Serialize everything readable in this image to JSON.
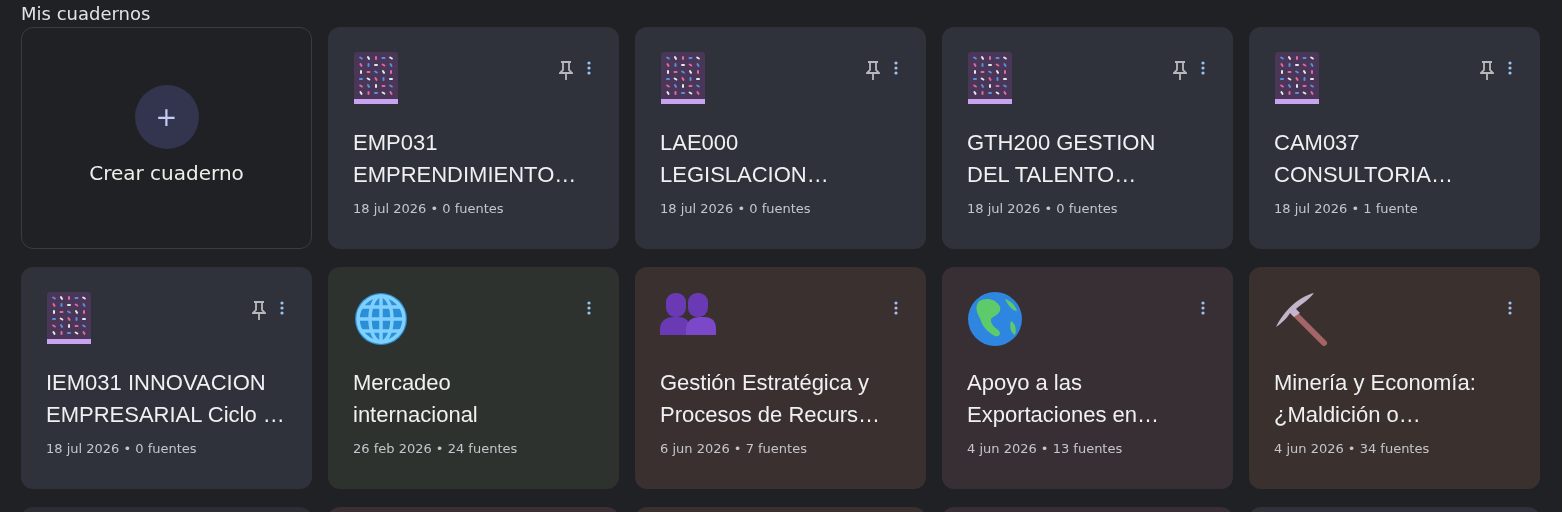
{
  "heading": "Mis cuadernos",
  "create_card": {
    "label": "Crear cuaderno",
    "button": "+"
  },
  "notebooks": [
    {
      "kind": "notebook",
      "color": "#30323b",
      "title": "EMP031\nEMPRENDIMIENTO…",
      "meta": "18 jul 2026 • 0 fuentes",
      "pinned": true
    },
    {
      "kind": "notebook",
      "color": "#30323b",
      "title": "LAE000\nLEGISLACION…",
      "meta": "18 jul 2026 • 0 fuentes",
      "pinned": true
    },
    {
      "kind": "notebook",
      "color": "#30323b",
      "title": "GTH200 GESTION\nDEL TALENTO…",
      "meta": "18 jul 2026 • 0 fuentes",
      "pinned": true
    },
    {
      "kind": "notebook",
      "color": "#30323b",
      "title": "CAM037\nCONSULTORIA…",
      "meta": "18 jul 2026 • 1 fuente",
      "pinned": true
    },
    {
      "kind": "notebook",
      "color": "#30323b",
      "title": "IEM031 INNOVACION\nEMPRESARIAL Ciclo …",
      "meta": "18 jul 2026 • 0 fuentes",
      "pinned": true
    },
    {
      "kind": "globe",
      "color": "#2d322f",
      "title": "Mercadeo\ninternacional",
      "meta": "26 feb 2026 • 24 fuentes",
      "pinned": false
    },
    {
      "kind": "people",
      "color": "#3a302f",
      "title": "Gestión Estratégica y\nProcesos de Recurs…",
      "meta": "6 jun 2026 • 7 fuentes",
      "pinned": false
    },
    {
      "kind": "earth",
      "color": "#382f35",
      "title": "Apoyo a las\nExportaciones en…",
      "meta": "4 jun 2026 • 13 fuentes",
      "pinned": false
    },
    {
      "kind": "pickaxe",
      "color": "#3a312f",
      "title": "Minería y Economía:\n¿Maldición o…",
      "meta": "4 jun 2026 • 34 fuentes",
      "pinned": false
    }
  ],
  "partial_cards": [
    {
      "color": "#2c2e35"
    },
    {
      "color": "#3a2f33"
    },
    {
      "color": "#3a302f"
    },
    {
      "color": "#382f35"
    },
    {
      "color": "#30323b"
    }
  ]
}
